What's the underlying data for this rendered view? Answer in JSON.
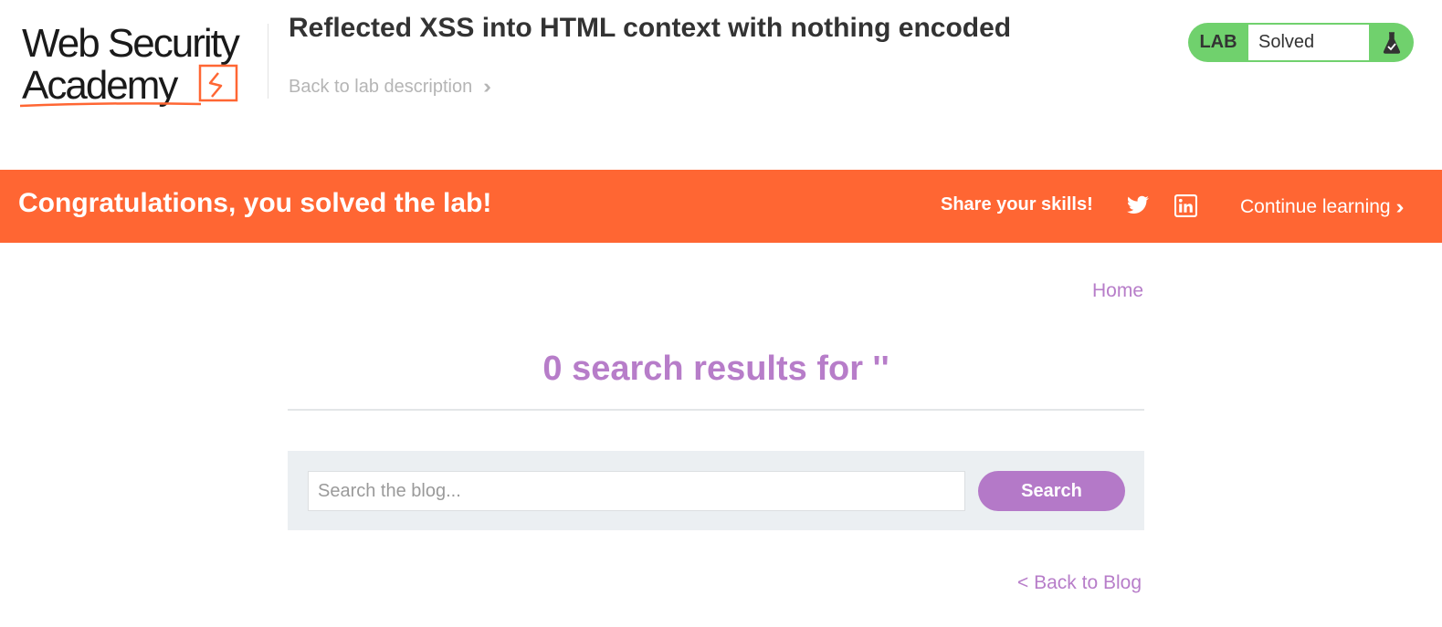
{
  "header": {
    "logo_line1": "Web Security",
    "logo_line2": "Academy",
    "lab_title": "Reflected XSS into HTML context with nothing encoded",
    "back_to_description": "Back to lab description",
    "lab_badge": "LAB",
    "lab_status": "Solved",
    "lab_icon": "flask-icon"
  },
  "banner": {
    "message": "Congratulations, you solved the lab!",
    "share_label": "Share your skills!",
    "share_icons": [
      "twitter-icon",
      "linkedin-icon"
    ],
    "continue_label": "Continue learning"
  },
  "main": {
    "home_link": "Home",
    "results_heading": "0 search results for ''",
    "search": {
      "placeholder": "Search the blog...",
      "value": "",
      "button_label": "Search"
    },
    "back_to_blog": "< Back to Blog"
  },
  "colors": {
    "brand_orange": "#ff6633",
    "solved_green": "#70d16d",
    "link_purple": "#b77dc9",
    "button_purple": "#b479c8",
    "panel_gray": "#ebeff2"
  }
}
